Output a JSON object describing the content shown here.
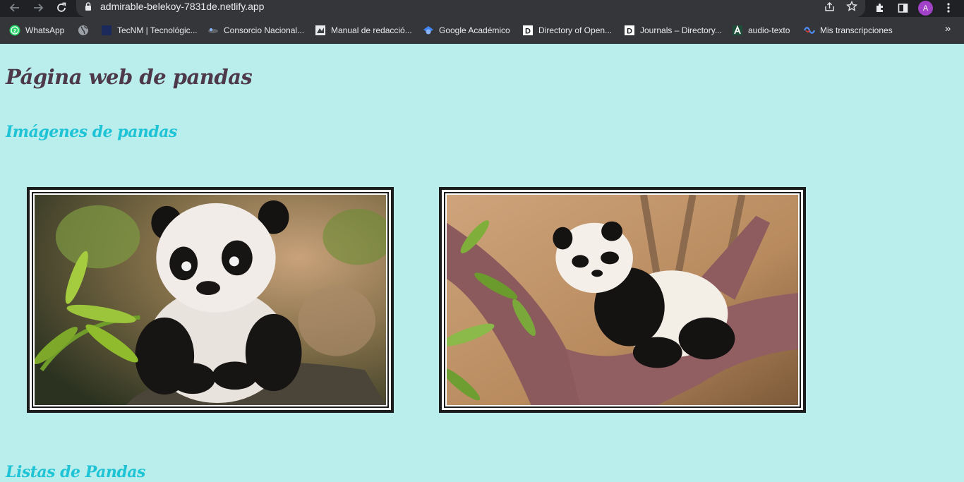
{
  "browser": {
    "url": "admirable-belekoy-7831de.netlify.app",
    "profile_initial": "A",
    "icons": [
      "back-icon",
      "forward-icon",
      "reload-icon",
      "lock-icon",
      "share-icon",
      "star-icon",
      "extensions-icon",
      "side-panel-icon",
      "menu-icon"
    ],
    "bookmarks": [
      {
        "label": "WhatsApp",
        "icon": "whatsapp-icon"
      },
      {
        "label": "",
        "icon": "globe-icon"
      },
      {
        "label": "TecNM | Tecnológic...",
        "icon": "tecnm-icon"
      },
      {
        "label": "Consorcio Nacional...",
        "icon": "consorcio-icon"
      },
      {
        "label": "Manual de redacció...",
        "icon": "manual-icon"
      },
      {
        "label": "Google Académico",
        "icon": "scholar-icon"
      },
      {
        "label": "Directory of Open...",
        "icon": "doaj-icon"
      },
      {
        "label": "Journals – Directory...",
        "icon": "doaj-icon"
      },
      {
        "label": "audio-texto",
        "icon": "audio-texto-icon"
      },
      {
        "label": "Mis transcripciones",
        "icon": "transcripciones-icon"
      }
    ],
    "more_label": "»",
    "accent": "#a142c9"
  },
  "page": {
    "title": "Página web de pandas",
    "section_images": "Imágenes de pandas",
    "section_lists": "Listas de Pandas",
    "colors": {
      "background": "#b9eeec",
      "title": "#4d3949",
      "heading": "#1fc3d6",
      "frame": "#1c1c1c"
    },
    "images": [
      {
        "subject": "panda-cub-sitting-photo"
      },
      {
        "subject": "panda-sleeping-on-tree-photo"
      }
    ]
  }
}
